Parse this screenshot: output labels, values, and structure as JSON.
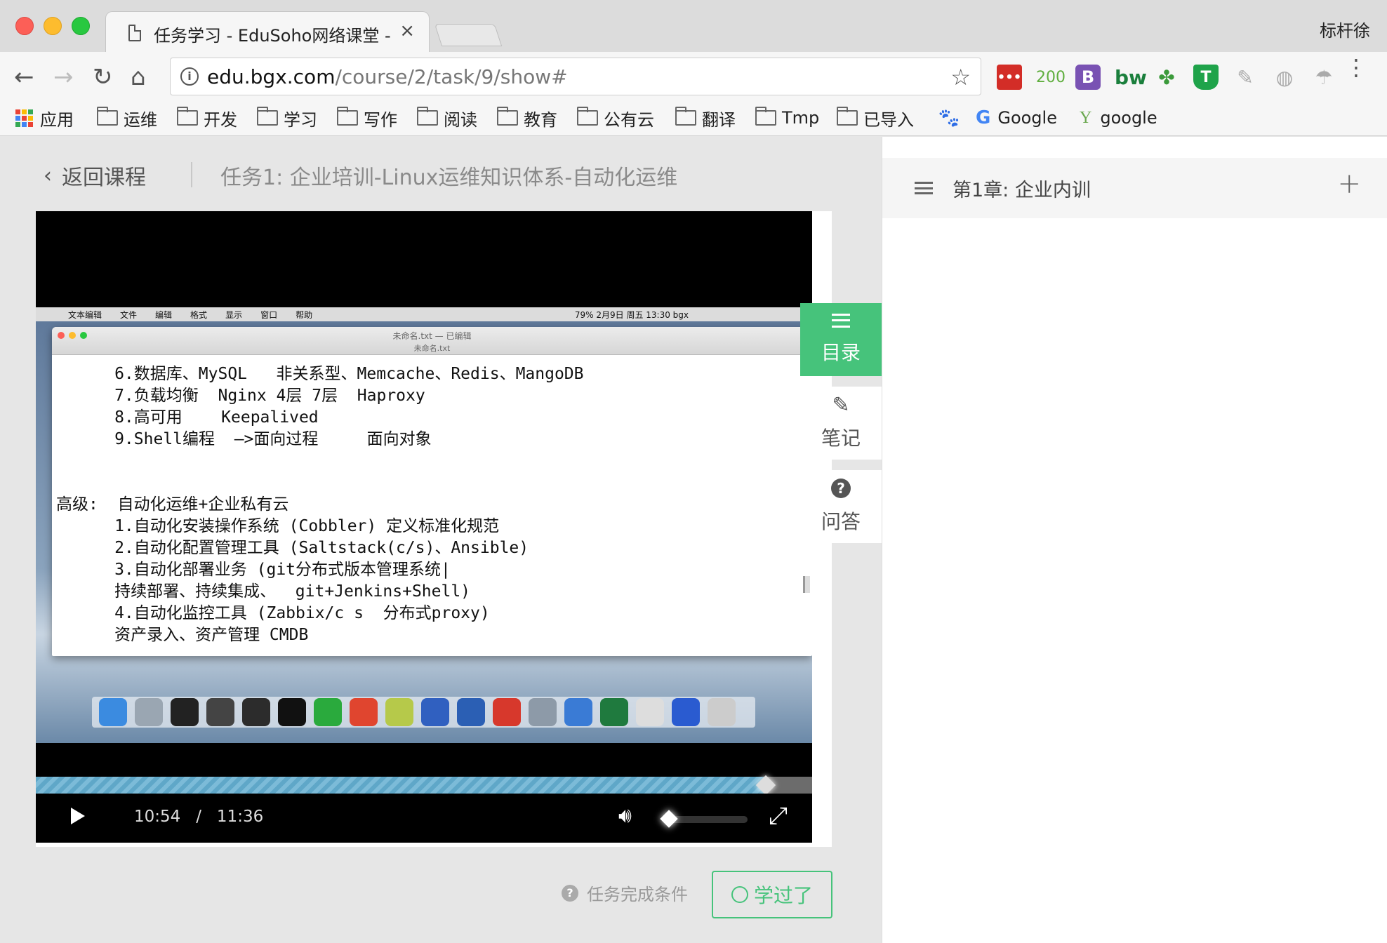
{
  "browser": {
    "tab_title": "任务学习 - EduSoho网络课堂 -",
    "tab_close": "×",
    "profile_name": "标杆徐",
    "url_host": "edu.bgx.com",
    "url_path": "/course/2/task/9/show#",
    "nav": {
      "back": "←",
      "forward": "→",
      "reload": "↻",
      "home": "⌂"
    },
    "extensions": [
      {
        "name": "extension-lastpass",
        "label": "•••",
        "color": "#d32d27"
      },
      {
        "name": "extension-counter",
        "label": "200",
        "color": "#5fae3e"
      },
      {
        "name": "extension-bootstrap",
        "label": "B",
        "color": "#7952b3"
      },
      {
        "name": "extension-bw",
        "label": "bw",
        "color": "#1a7f3c"
      },
      {
        "name": "extension-clover",
        "label": "✤",
        "color": "#3b9a3a"
      },
      {
        "name": "extension-shield",
        "label": "T",
        "color": "#1fa34a"
      },
      {
        "name": "extension-grey-1",
        "label": "✎",
        "color": "#aaaaaa"
      },
      {
        "name": "extension-grey-2",
        "label": "◍",
        "color": "#aaaaaa"
      },
      {
        "name": "extension-grey-3",
        "label": "☂",
        "color": "#aaaaaa"
      }
    ],
    "bookmarks": [
      {
        "label": "应用",
        "type": "apps"
      },
      {
        "label": "运维",
        "type": "folder"
      },
      {
        "label": "开发",
        "type": "folder"
      },
      {
        "label": "学习",
        "type": "folder"
      },
      {
        "label": "写作",
        "type": "folder"
      },
      {
        "label": "阅读",
        "type": "folder"
      },
      {
        "label": "教育",
        "type": "folder"
      },
      {
        "label": "公有云",
        "type": "folder"
      },
      {
        "label": "翻译",
        "type": "folder"
      },
      {
        "label": "Tmp",
        "type": "folder"
      },
      {
        "label": "已导入",
        "type": "folder"
      },
      {
        "label": "",
        "type": "baidu"
      },
      {
        "label": "Google",
        "type": "google"
      },
      {
        "label": "google",
        "type": "yandex"
      }
    ]
  },
  "header": {
    "back_label": "返回课程",
    "task_title": "任务1:  企业培训-Linux运维知识体系-自动化运维"
  },
  "video": {
    "current_time": "10:54",
    "separator": "/",
    "duration": "11:36",
    "progress": 0.94,
    "volume": 0.1,
    "screen": {
      "menubar": [
        "文本编辑",
        "文件",
        "编辑",
        "格式",
        "显示",
        "窗口",
        "帮助"
      ],
      "menubar_right": "79%   2月9日 周五 13:30  bgx",
      "window_title": "未命名.txt — 已编辑",
      "window_subtitle": "未命名.txt",
      "lines": [
        "      6.数据库、MySQL   非关系型、Memcache、Redis、MangoDB",
        "      7.负载均衡  Nginx 4层 7层  Haproxy",
        "      8.高可用    Keepalived",
        "      9.Shell编程  —>面向过程     面向对象",
        "",
        "",
        "高级:  自动化运维+企业私有云",
        "      1.自动化安装操作系统 (Cobbler) 定义标准化规范",
        "      2.自动化配置管理工具 (Saltstack(c/s)、Ansible)",
        "      3.自动化部署业务 (git分布式版本管理系统|",
        "      持续部署、持续集成、  git+Jenkins+Shell)",
        "      4.自动化监控工具 (Zabbix/c s  分布式proxy)",
        "      资产录入、资产管理 CMDB"
      ]
    }
  },
  "side_tabs": [
    {
      "label": "目录",
      "icon": "menu-icon",
      "active": true
    },
    {
      "label": "笔记",
      "icon": "pencil-icon",
      "active": false
    },
    {
      "label": "问答",
      "icon": "question-icon",
      "active": false
    }
  ],
  "footer": {
    "condition_label": "任务完成条件",
    "learned_label": "学过了"
  },
  "sidebar": {
    "chapter_title": "第1章: 企业内训",
    "add_symbol": "+"
  },
  "colors": {
    "accent": "#46c37b"
  }
}
